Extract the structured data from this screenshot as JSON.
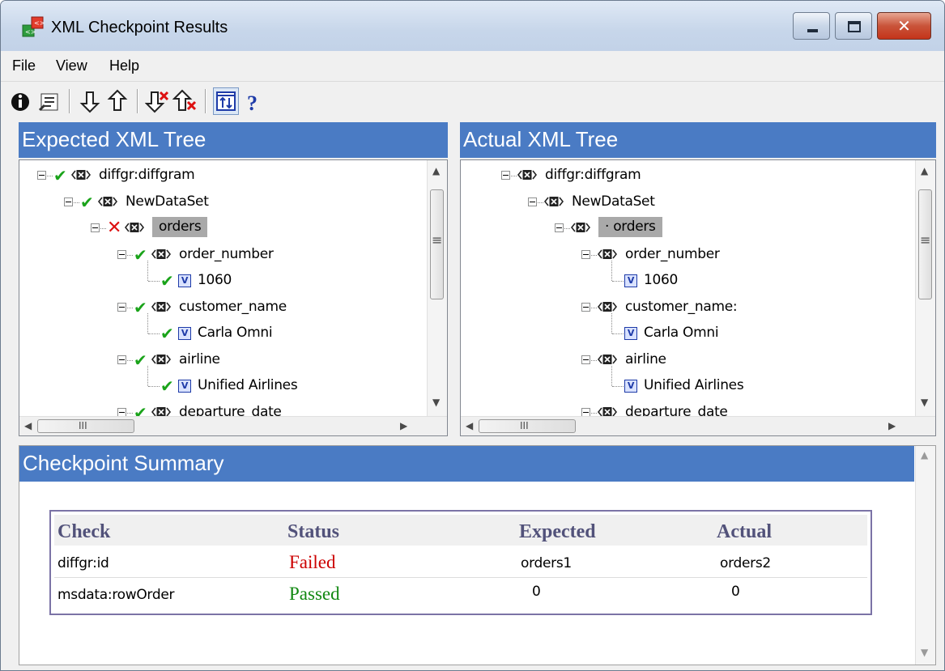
{
  "window": {
    "title": "XML Checkpoint Results"
  },
  "menu": [
    "File",
    "View",
    "Help"
  ],
  "toolbar": {
    "buttons": [
      "info-icon",
      "properties-icon",
      "next-difference-icon",
      "previous-difference-icon",
      "next-failure-icon",
      "previous-failure-icon",
      "sync-trees-icon",
      "help-icon"
    ]
  },
  "expected": {
    "header": "Expected XML Tree",
    "nodes": [
      {
        "label": "diffgr:diffgram",
        "status": "passed",
        "kind": "element"
      },
      {
        "label": "NewDataSet",
        "status": "passed",
        "kind": "element"
      },
      {
        "label": "orders",
        "status": "failed",
        "kind": "element",
        "selected": true
      },
      {
        "label": "order_number",
        "status": "passed",
        "kind": "element"
      },
      {
        "label": "1060",
        "status": "passed",
        "kind": "value"
      },
      {
        "label": "customer_name",
        "status": "passed",
        "kind": "element"
      },
      {
        "label": "Carla Omni",
        "status": "passed",
        "kind": "value"
      },
      {
        "label": "airline",
        "status": "passed",
        "kind": "element"
      },
      {
        "label": "Unified Airlines",
        "status": "passed",
        "kind": "value"
      },
      {
        "label": "departure_date",
        "status": "passed",
        "kind": "element"
      }
    ]
  },
  "actual": {
    "header": "Actual XML Tree",
    "nodes": [
      {
        "label": "diffgr:diffgram",
        "kind": "element"
      },
      {
        "label": "NewDataSet",
        "kind": "element"
      },
      {
        "label": "· orders",
        "kind": "element",
        "selected": true
      },
      {
        "label": "order_number",
        "kind": "element"
      },
      {
        "label": "1060",
        "kind": "value"
      },
      {
        "label": "customer_name:",
        "kind": "element"
      },
      {
        "label": "Carla Omni",
        "kind": "value"
      },
      {
        "label": "airline",
        "kind": "element"
      },
      {
        "label": "Unified Airlines",
        "kind": "value"
      },
      {
        "label": "departure_date",
        "kind": "element"
      }
    ]
  },
  "scroll_glyphs": {
    "up": "▲",
    "down": "▼",
    "left": "◀",
    "right": "▶",
    "grip_v": "≡",
    "grip_h": "III"
  },
  "summary": {
    "header": "Checkpoint Summary",
    "columns": [
      "Check",
      "Status",
      "Expected",
      "Actual"
    ],
    "rows": [
      {
        "check": "diffgr:id",
        "status": "Failed",
        "expected": "orders1",
        "actual": "orders2"
      },
      {
        "check": "msdata:rowOrder",
        "status": "Passed",
        "expected": "0",
        "actual": "0"
      }
    ]
  },
  "colors": {
    "header_blue": "#4a7bc4",
    "failed": "#cc0000",
    "passed": "#118811",
    "check_green": "#1aa31a"
  }
}
